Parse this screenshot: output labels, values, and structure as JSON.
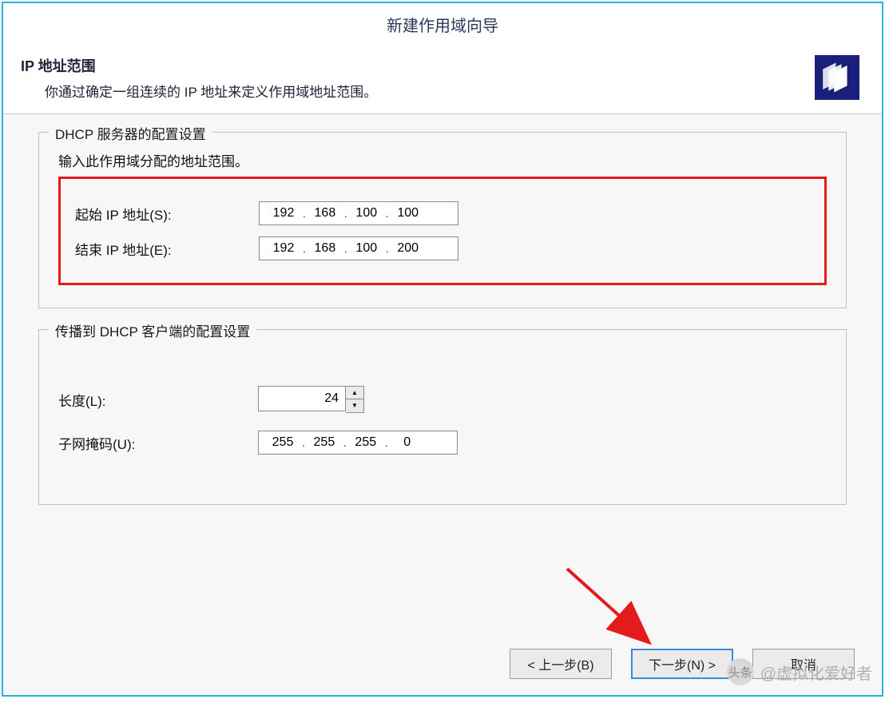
{
  "window": {
    "title": "新建作用域向导"
  },
  "header": {
    "title": "IP 地址范围",
    "desc": "你通过确定一组连续的 IP 地址来定义作用域地址范围。"
  },
  "group1": {
    "legend": "DHCP 服务器的配置设置",
    "rangeLabel": "输入此作用域分配的地址范围。",
    "start": {
      "label": "起始 IP 地址(S):",
      "oct1": "192",
      "oct2": "168",
      "oct3": "100",
      "oct4": "100"
    },
    "end": {
      "label": "结束 IP 地址(E):",
      "oct1": "192",
      "oct2": "168",
      "oct3": "100",
      "oct4": "200"
    }
  },
  "group2": {
    "legend": "传播到 DHCP 客户端的配置设置",
    "length": {
      "label": "长度(L):",
      "value": "24"
    },
    "mask": {
      "label": "子网掩码(U):",
      "oct1": "255",
      "oct2": "255",
      "oct3": "255",
      "oct4": "0"
    }
  },
  "buttons": {
    "back": "< 上一步(B)",
    "next": "下一步(N) >",
    "cancel": "取消"
  },
  "watermark": {
    "badge": "头条",
    "text": "@虚拟化爱好者"
  }
}
